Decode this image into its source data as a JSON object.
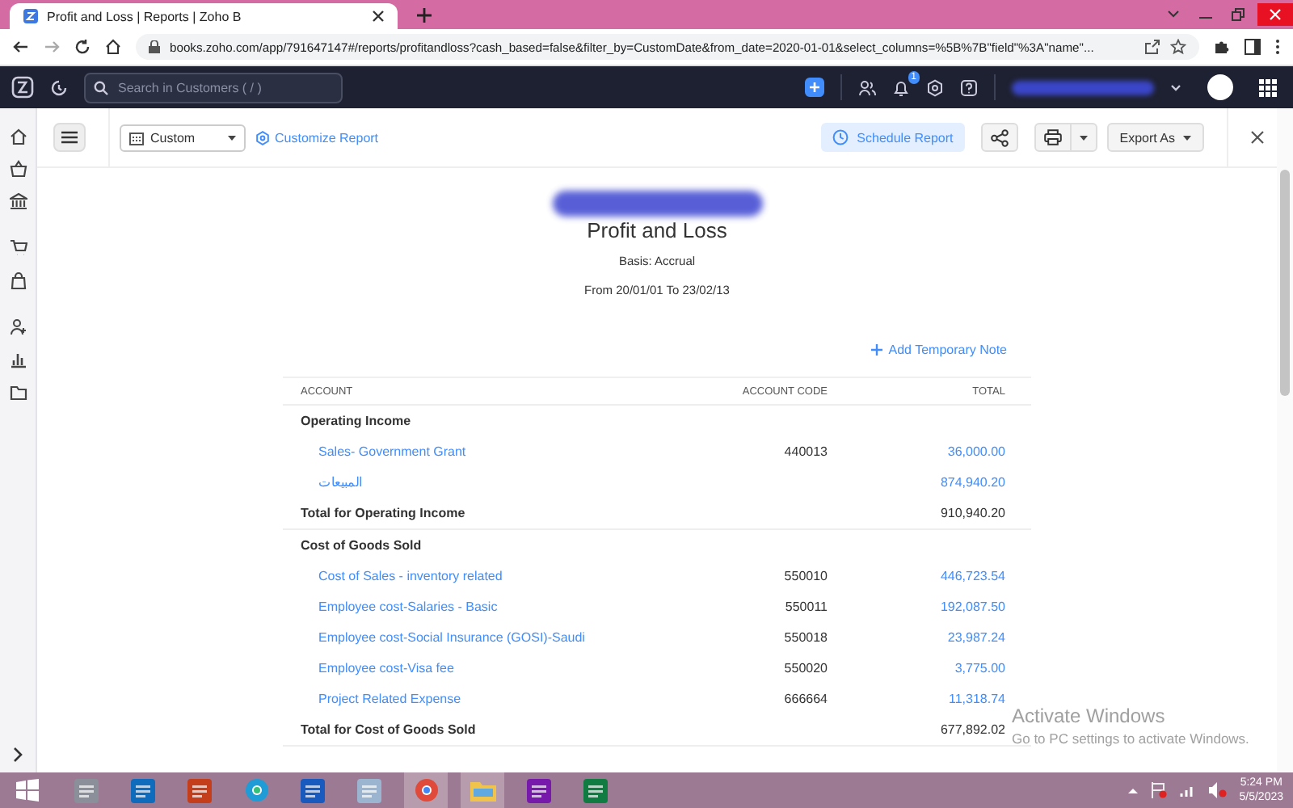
{
  "browser": {
    "tab_title": "Profit and Loss | Reports | Zoho B",
    "url": "books.zoho.com/app/791647147#/reports/profitandloss?cash_based=false&filter_by=CustomDate&from_date=2020-01-01&select_columns=%5B%7B\"field\"%3A\"name\"..."
  },
  "app_bar": {
    "search_placeholder": "Search in Customers ( / )",
    "notification_count": "1"
  },
  "toolbar": {
    "period": "Custom",
    "customize": "Customize Report",
    "schedule": "Schedule Report",
    "export": "Export As"
  },
  "report": {
    "title": "Profit and Loss",
    "basis": "Basis: Accrual",
    "range": "From 20/01/01 To 23/02/13",
    "add_note": "Add Temporary Note",
    "columns": [
      "ACCOUNT",
      "ACCOUNT CODE",
      "TOTAL"
    ],
    "sections": [
      {
        "title": "Operating Income",
        "rows": [
          {
            "account": "Sales- Government Grant",
            "code": "440013",
            "total": "36,000.00"
          },
          {
            "account": "المبيعات",
            "code": "",
            "total": "874,940.20"
          }
        ],
        "total_label": "Total for Operating Income",
        "total_value": "910,940.20"
      },
      {
        "title": "Cost of Goods Sold",
        "rows": [
          {
            "account": "Cost of Sales - inventory related",
            "code": "550010",
            "total": "446,723.54"
          },
          {
            "account": "Employee cost-Salaries - Basic",
            "code": "550011",
            "total": "192,087.50"
          },
          {
            "account": "Employee cost-Social Insurance (GOSI)-Saudi",
            "code": "550018",
            "total": "23,987.24"
          },
          {
            "account": "Employee cost-Visa fee",
            "code": "550020",
            "total": "3,775.00"
          },
          {
            "account": "Project Related Expense",
            "code": "666664",
            "total": "11,318.74"
          }
        ],
        "total_label": "Total for Cost of Goods Sold",
        "total_value": "677,892.02"
      }
    ]
  },
  "activation": {
    "title": "Activate Windows",
    "subtitle": "Go to PC settings to activate Windows."
  },
  "taskbar": {
    "apps": [
      {
        "kind": "printer",
        "selected": false
      },
      {
        "kind": "mail",
        "selected": false
      },
      {
        "kind": "slides",
        "selected": false
      },
      {
        "kind": "browser-edge",
        "selected": false
      },
      {
        "kind": "doc",
        "selected": false
      },
      {
        "kind": "calculator",
        "selected": false
      },
      {
        "kind": "browser-chrome",
        "selected": true
      },
      {
        "kind": "folder",
        "selected": true
      },
      {
        "kind": "notes",
        "selected": false
      },
      {
        "kind": "sheet",
        "selected": false
      }
    ],
    "time": "5:24 PM",
    "date": "5/5/2023"
  }
}
